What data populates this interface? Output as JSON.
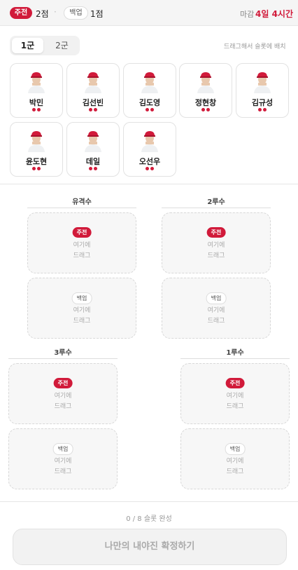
{
  "header": {
    "starter_badge": "주전",
    "starter_points": "2점",
    "backup_badge": "백업",
    "backup_points": "1점",
    "deadline_label": "마감",
    "deadline_value": "4일 4시간"
  },
  "tabs": [
    {
      "label": "1군",
      "active": true
    },
    {
      "label": "2군",
      "active": false
    }
  ],
  "hint": "드래그해서 슬롯에 배치",
  "players": [
    {
      "name": "박민",
      "dots": 2
    },
    {
      "name": "김선빈",
      "dots": 2
    },
    {
      "name": "김도영",
      "dots": 2
    },
    {
      "name": "정현창",
      "dots": 2
    },
    {
      "name": "김규성",
      "dots": 2
    },
    {
      "name": "윤도현",
      "dots": 2
    },
    {
      "name": "데일",
      "dots": 2
    },
    {
      "name": "오선우",
      "dots": 2
    }
  ],
  "positions": [
    {
      "title": "유격수",
      "starter_badge": "주전",
      "backup_badge": "백업",
      "drop_text_1": "여기에",
      "drop_text_2": "드래그"
    },
    {
      "title": "2루수",
      "starter_badge": "주전",
      "backup_badge": "백업",
      "drop_text_1": "여기에",
      "drop_text_2": "드래그"
    },
    {
      "title": "3루수",
      "starter_badge": "주전",
      "backup_badge": "백업",
      "drop_text_1": "여기에",
      "drop_text_2": "드래그"
    },
    {
      "title": "1루수",
      "starter_badge": "주전",
      "backup_badge": "백업",
      "drop_text_1": "여기에",
      "drop_text_2": "드래그"
    }
  ],
  "progress_text": "0 / 8 슬롯 완성",
  "confirm_button": "나만의 내야진 확정하기",
  "colors": {
    "accent": "#d11a3a",
    "background": "#ffffff"
  }
}
